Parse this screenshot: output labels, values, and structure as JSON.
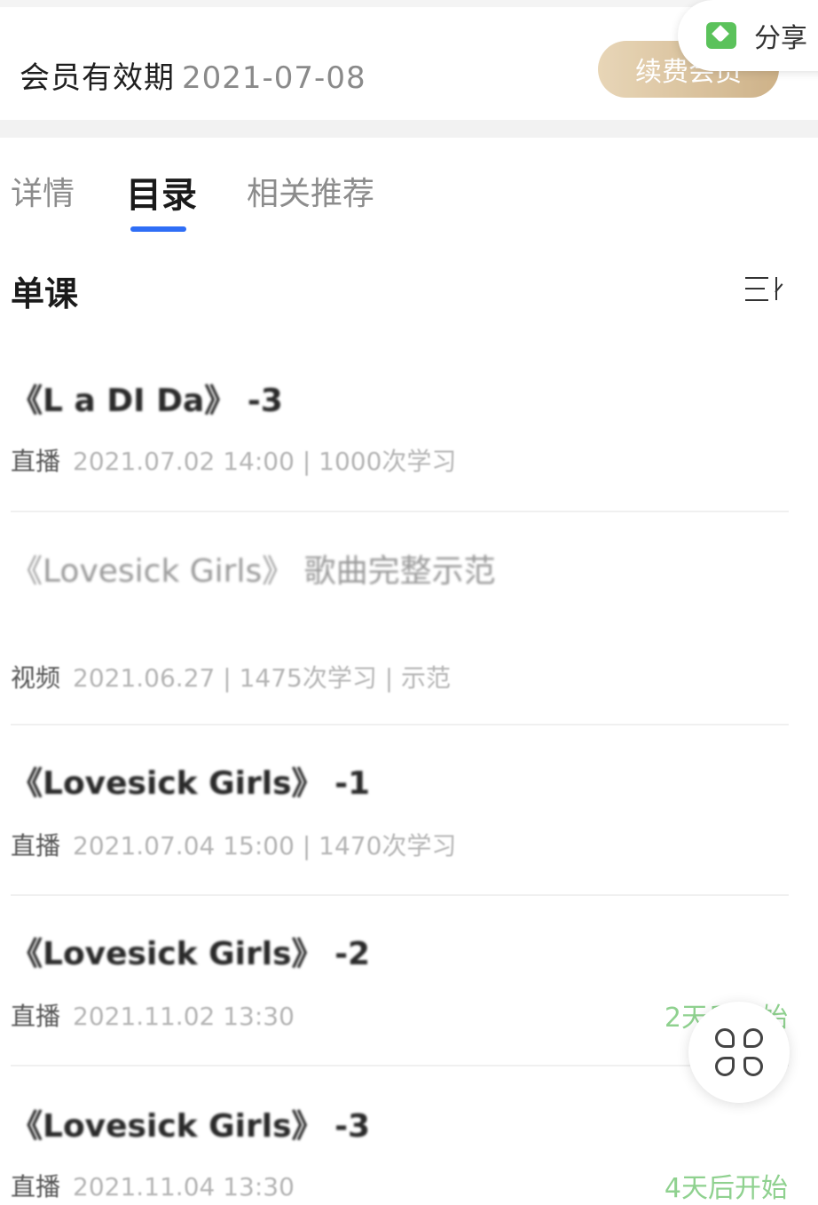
{
  "membership": {
    "label": "会员有效期",
    "expiry_date": "2021-07-08",
    "renew_button": "续费会员"
  },
  "share": {
    "label": "分享",
    "icon": "share-heart-icon"
  },
  "tabs": [
    {
      "label": "详情",
      "active": false
    },
    {
      "label": "目录",
      "active": true
    },
    {
      "label": "相关推荐",
      "active": false
    }
  ],
  "accent_color": "#2f6ef6",
  "section": {
    "title": "单课",
    "sort_icon": "sort-icon"
  },
  "lessons": [
    {
      "title": "《L a DI Da》 -3",
      "type": "直播",
      "meta": "2021.07.02 14:00 | 1000次学习",
      "status": ""
    },
    {
      "title": "《Lovesick Girls》 歌曲完整示范",
      "type": "视频",
      "meta": "2021.06.27 | 1475次学习 | 示范",
      "status": ""
    },
    {
      "title": "《Lovesick Girls》 -1",
      "type": "直播",
      "meta": "2021.07.04 15:00 | 1470次学习",
      "status": ""
    },
    {
      "title": "《Lovesick Girls》 -2",
      "type": "直播",
      "meta": "2021.11.02 13:30",
      "status": "2天后开始"
    },
    {
      "title": "《Lovesick Girls》 -3",
      "type": "直播",
      "meta": "2021.11.04 13:30",
      "status": "4天后开始"
    }
  ],
  "fab": {
    "icon": "clover-menu-icon"
  }
}
